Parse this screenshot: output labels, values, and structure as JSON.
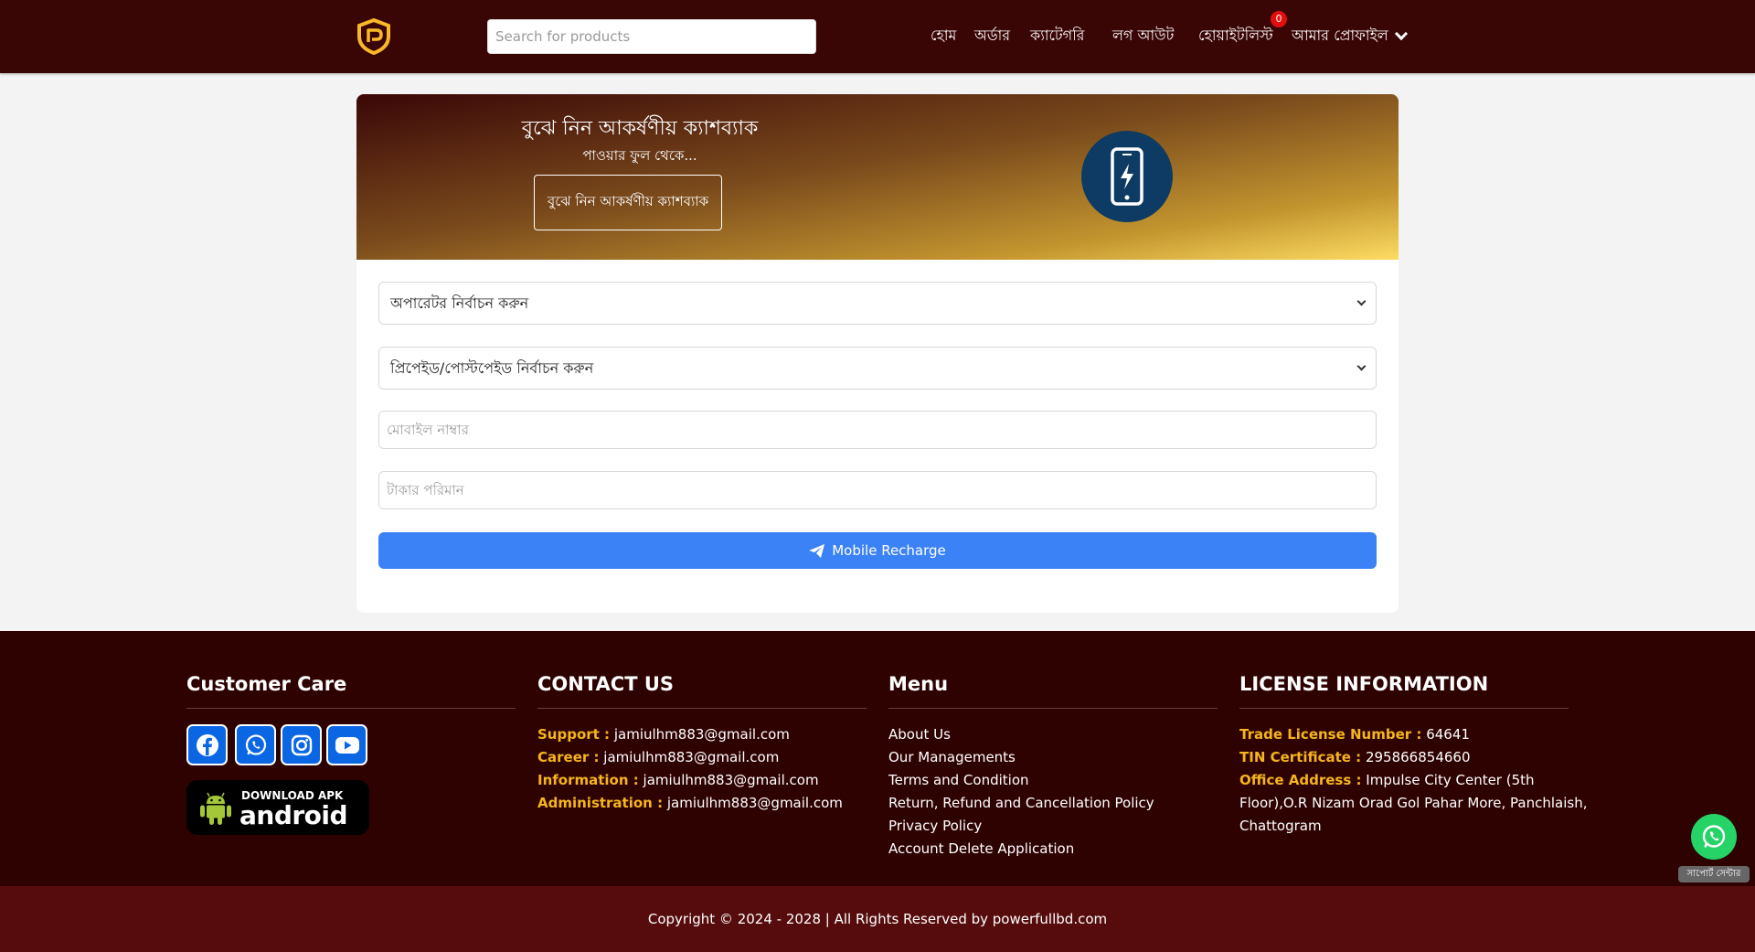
{
  "header": {
    "search_placeholder": "Search for products",
    "nav": {
      "home": "হোম",
      "order": "অর্ডার",
      "category": "ক্যাটেগরি",
      "logout": "লগ আউট",
      "wishlist": "হোয়াইটলিস্ট",
      "wishlist_count": "0",
      "profile": "আমার প্রোফাইল"
    }
  },
  "hero": {
    "title": "বুঝে নিন আকর্ষণীয় ক্যাশব্যাক",
    "subtitle": "পাওয়ার ফুল থেকে...",
    "button_label": "বুঝে নিন আকর্ষণীয় ক্যাশব্যাক"
  },
  "form": {
    "operator_select": "অপারেটর নির্বাচন করুন",
    "type_select": "প্রিপেইড/পোস্টপেইড নির্বাচন করুন",
    "mobile_placeholder": "মোবাইল নাম্বার",
    "amount_placeholder": "টাকার পরিমান",
    "submit_label": "Mobile Recharge"
  },
  "footer": {
    "customer_care": {
      "title": "Customer Care",
      "apk_line1": "DOWNLOAD APK",
      "apk_line2": "android"
    },
    "contact": {
      "title": "CONTACT US",
      "rows": [
        {
          "key": "Support :",
          "value": "jamiulhm883@gmail.com"
        },
        {
          "key": "Career :",
          "value": "jamiulhm883@gmail.com"
        },
        {
          "key": "Information :",
          "value": "jamiulhm883@gmail.com"
        },
        {
          "key": "Administration :",
          "value": "jamiulhm883@gmail.com"
        }
      ]
    },
    "menu": {
      "title": "Menu",
      "items": [
        "About Us",
        "Our Managements",
        "Terms and Condition",
        "Return, Refund and Cancellation Policy",
        "Privacy Policy",
        "Account Delete Application"
      ]
    },
    "license": {
      "title": "LICENSE INFORMATION",
      "trade_key": "Trade License Number :",
      "trade_value": "64641",
      "tin_key": "TIN Certificate :",
      "tin_value": "295866854660",
      "office_key": "Office Address :",
      "office_value_1": "Impulse City Center (5th",
      "office_value_2": "Floor),O.R Nizam Orad Gol Pahar More, Panchlaish,",
      "office_value_3": "Chattogram"
    },
    "copyright": "Copyright © 2024 - 2028 | All Rights Reserved by powerfullbd.com",
    "support_chip": "সাপোর্ট সেন্টার"
  },
  "colors": {
    "header_bg": "#3a0505",
    "footer_bg": "#2f0202",
    "copyright_bg": "#560c0c",
    "accent_blue": "#3b82f6",
    "footer_key": "#f5b51b"
  }
}
